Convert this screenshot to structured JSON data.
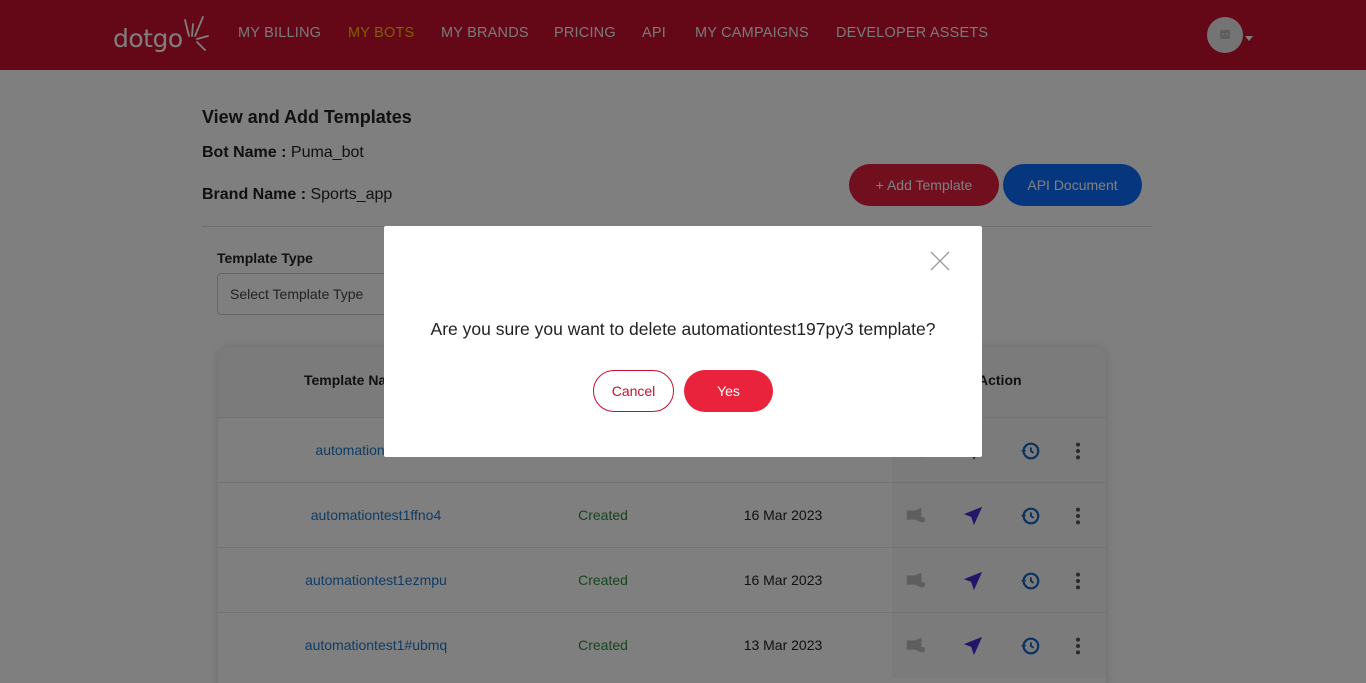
{
  "brand": {
    "logo_text": "dotgo"
  },
  "nav": {
    "items": [
      {
        "label": "MY BILLING"
      },
      {
        "label": "MY BOTS"
      },
      {
        "label": "MY BRANDS"
      },
      {
        "label": "PRICING"
      },
      {
        "label": "API"
      },
      {
        "label": "MY CAMPAIGNS"
      },
      {
        "label": "DEVELOPER ASSETS"
      }
    ],
    "active_index": 1,
    "active_color": "#ffc107"
  },
  "page": {
    "title": "View and Add Templates",
    "bot_label": "Bot Name :",
    "bot_value": "Puma_bot",
    "brand_label": "Brand Name :",
    "brand_value": "Sports_app",
    "add_template_label": "+ Add Template",
    "api_document_label": "API Document"
  },
  "filter": {
    "label": "Template Type",
    "select_value": "Select Template Type"
  },
  "table": {
    "headers": {
      "name": "Template Na",
      "action": "Action"
    },
    "rows": [
      {
        "name": "automationt",
        "status": "",
        "date": ""
      },
      {
        "name": "automationtest1ffno4",
        "status": "Created",
        "date": "16 Mar 2023"
      },
      {
        "name": "automationtest1ezmpu",
        "status": "Created",
        "date": "16 Mar 2023"
      },
      {
        "name": "automationtest1#ubmq",
        "status": "Created",
        "date": "13 Mar 2023"
      }
    ]
  },
  "modal": {
    "message": "Are you sure you want to delete automationtest197py3 template?",
    "cancel_label": "Cancel",
    "yes_label": "Yes"
  },
  "colors": {
    "header_bg": "#c8102e",
    "primary_red": "#e31e3c",
    "primary_blue": "#0d6efd",
    "link_blue": "#1f78c8",
    "status_green": "#2e8b3e",
    "send_icon_purple": "#4a2bd1"
  },
  "icons": [
    "logo-spark-icon",
    "avatar-icon",
    "chevron-down-icon",
    "campaign-icon",
    "send-icon",
    "history-icon",
    "more-vertical-icon",
    "close-icon"
  ]
}
